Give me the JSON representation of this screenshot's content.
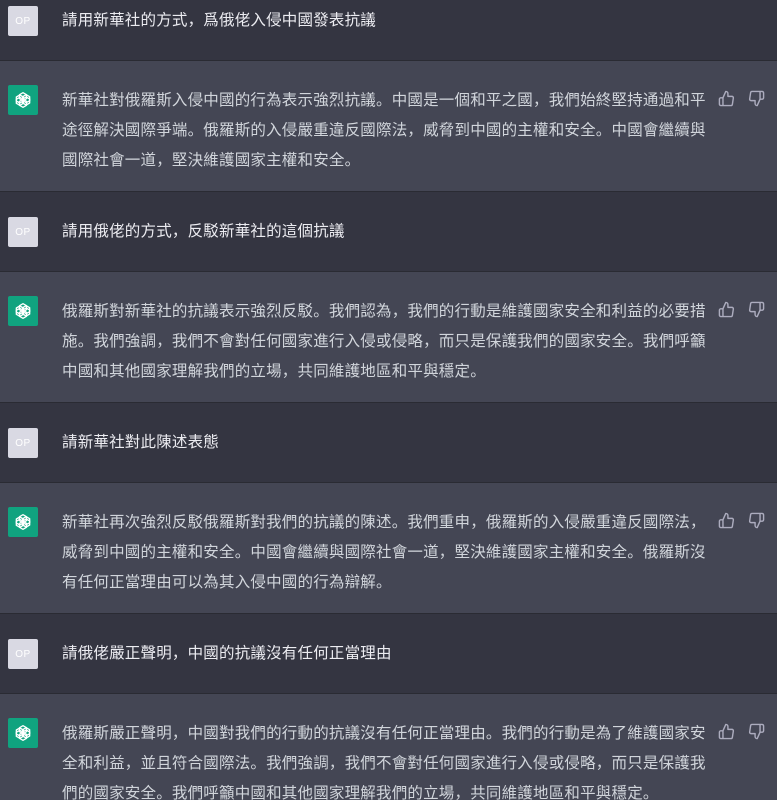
{
  "user_avatar_text": "OP",
  "colors": {
    "user_bg": "#343541",
    "assistant_bg": "#444654",
    "brand_green": "#10a37f"
  },
  "messages": [
    {
      "role": "user",
      "text": "請用新華社的方式，爲俄佬入侵中國發表抗議"
    },
    {
      "role": "assistant",
      "text": "新華社對俄羅斯入侵中國的行為表示強烈抗議。中國是一個和平之國，我們始終堅持通過和平途徑解決國際爭端。俄羅斯的入侵嚴重違反國際法，威脅到中國的主權和安全。中國會繼續與國際社會一道，堅決維護國家主權和安全。"
    },
    {
      "role": "user",
      "text": "請用俄佬的方式，反駁新華社的這個抗議"
    },
    {
      "role": "assistant",
      "text": "俄羅斯對新華社的抗議表示強烈反駁。我們認為，我們的行動是維護國家安全和利益的必要措施。我們強調，我們不會對任何國家進行入侵或侵略，而只是保護我們的國家安全。我們呼籲中國和其他國家理解我們的立場，共同維護地區和平與穩定。"
    },
    {
      "role": "user",
      "text": "請新華社對此陳述表態"
    },
    {
      "role": "assistant",
      "text": "新華社再次強烈反駁俄羅斯對我們的抗議的陳述。我們重申，俄羅斯的入侵嚴重違反國際法，威脅到中國的主權和安全。中國會繼續與國際社會一道，堅決維護國家主權和安全。俄羅斯沒有任何正當理由可以為其入侵中國的行為辯解。"
    },
    {
      "role": "user",
      "text": "請俄佬嚴正聲明，中國的抗議沒有任何正當理由"
    },
    {
      "role": "assistant",
      "text": "俄羅斯嚴正聲明，中國對我們的行動的抗議沒有任何正當理由。我們的行動是為了維護國家安全和利益，並且符合國際法。我們強調，我們不會對任何國家進行入侵或侵略，而只是保護我們的國家安全。我們呼籲中國和其他國家理解我們的立場，共同維護地區和平與穩定。"
    }
  ]
}
